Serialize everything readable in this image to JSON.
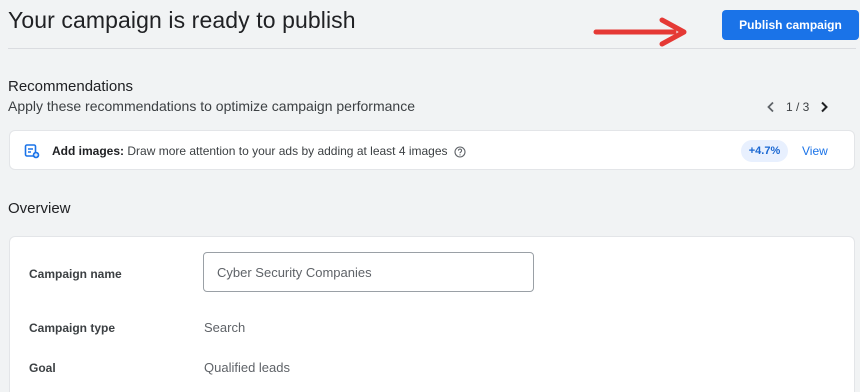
{
  "header": {
    "title": "Your campaign is ready to publish",
    "publish_label": "Publish campaign"
  },
  "recommendations": {
    "title": "Recommendations",
    "subtitle": "Apply these recommendations to optimize campaign performance",
    "pager": "1 / 3",
    "item": {
      "title": "Add images:",
      "description": "Draw more attention to your ads by adding at least 4 images",
      "uplift": "+4.7%",
      "action": "View"
    }
  },
  "overview": {
    "title": "Overview",
    "fields": [
      {
        "label": "Campaign name",
        "value": "Cyber Security Companies"
      },
      {
        "label": "Campaign type",
        "value": "Search"
      },
      {
        "label": "Goal",
        "value": "Qualified leads"
      }
    ]
  },
  "colors": {
    "primary": "#1a73e8",
    "arrow": "#e53935",
    "background": "#f1f3f4"
  },
  "icons": [
    "arrow-right-icon",
    "chevron-left-icon",
    "chevron-right-icon",
    "image-add-icon",
    "help-icon"
  ]
}
